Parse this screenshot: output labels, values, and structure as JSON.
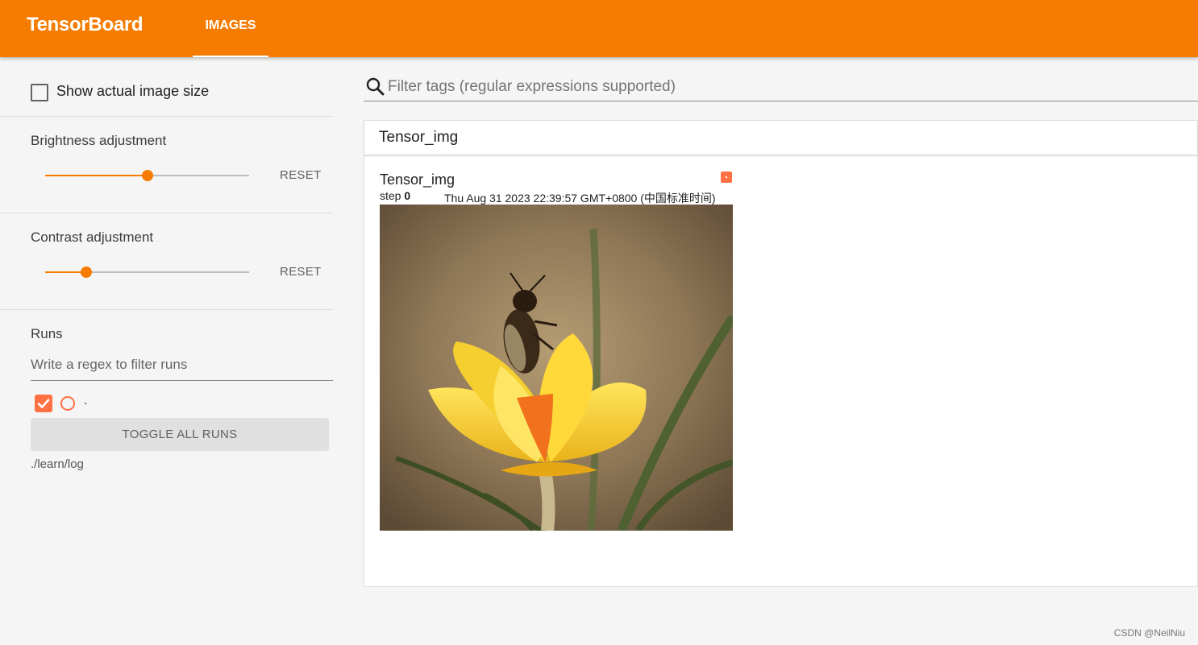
{
  "header": {
    "brand": "TensorBoard",
    "tabs": [
      {
        "label": "IMAGES",
        "active": true
      }
    ],
    "accent_color": "#f57c00"
  },
  "sidebar": {
    "show_actual_size": {
      "label": "Show actual image size",
      "checked": false
    },
    "brightness": {
      "title": "Brightness adjustment",
      "value": 0.5,
      "reset_label": "RESET"
    },
    "contrast": {
      "title": "Contrast adjustment",
      "value": 0.2,
      "reset_label": "RESET"
    },
    "runs": {
      "title": "Runs",
      "filter_placeholder": "Write a regex to filter runs",
      "items": [
        {
          "name": ".",
          "checked": true,
          "color": "#ff7043"
        }
      ],
      "toggle_all_label": "TOGGLE ALL RUNS",
      "logdir": "./learn/log"
    }
  },
  "main": {
    "filter_placeholder": "Filter tags (regular expressions supported)",
    "search_icon": "search-icon",
    "groups": [
      {
        "title": "Tensor_img",
        "cards": [
          {
            "title": "Tensor_img",
            "step_label": "step",
            "step": "0",
            "wall_time": "Thu Aug 31 2023 22:39:57 GMT+0800 (中国标准时间)",
            "image_desc": "bee-on-yellow-flower"
          }
        ]
      }
    ]
  },
  "watermark": "CSDN @NeilNiu"
}
